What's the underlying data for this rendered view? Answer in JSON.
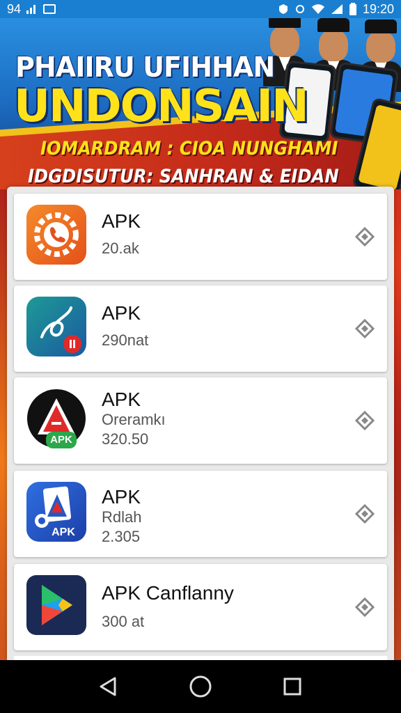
{
  "status_bar": {
    "left_text": "94",
    "time": "19:20"
  },
  "banner": {
    "title_line1": "PHAIIRU UFIHHAN",
    "title_line2": "UNDONSAIN",
    "subtitle_line1": "IOMARDRAM : CIOA NUNGHAMI",
    "subtitle_line2": "IDGDISUTUR: SANHRAN & EIDAN"
  },
  "apps": [
    {
      "name": "APK",
      "line1": "20.ak",
      "line2": "",
      "icon": "gear-phone-icon",
      "accent": "#f06a1e"
    },
    {
      "name": "APK",
      "line1": "290nat",
      "line2": "",
      "icon": "swirl-pen-icon",
      "accent": "#1f8a8a"
    },
    {
      "name": "APK",
      "line1": "Oreramkı",
      "line2": "320.50",
      "icon": "red-a-triangle-icon",
      "badge": "APK",
      "accent": "#e02a2a"
    },
    {
      "name": "APK",
      "line1": "Rdlah",
      "line2": "2.305",
      "icon": "blue-a-apk-icon",
      "badge": "APK",
      "accent": "#2458c8"
    },
    {
      "name": "APK Canflanny",
      "line1": "300 at",
      "line2": "",
      "icon": "play-store-icon",
      "accent": "#1b2a55"
    }
  ],
  "nav": {
    "back": "back-icon",
    "home": "home-icon",
    "recents": "recents-icon"
  },
  "colors": {
    "status_bar": "#1a7fd0",
    "banner_yellow": "#ffe21a",
    "background_red": "#a81c1c"
  }
}
